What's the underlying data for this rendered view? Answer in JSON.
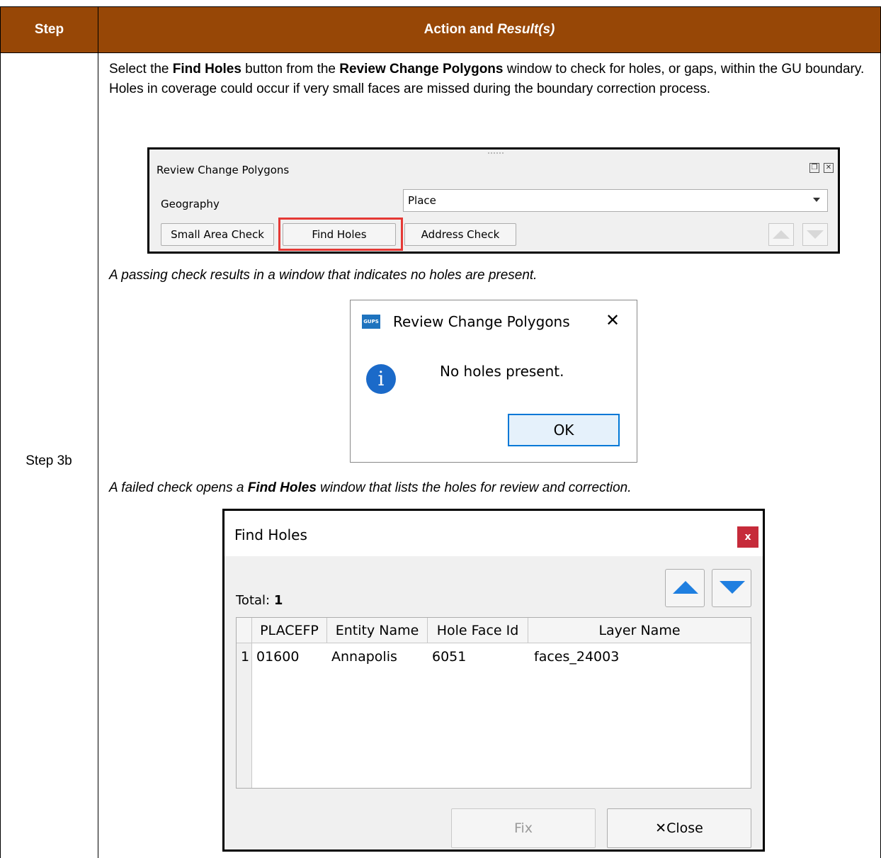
{
  "header": {
    "step_label": "Step",
    "action_label_plain": "Action and ",
    "action_label_italic": "Result(s)"
  },
  "row": {
    "step": "Step 3b",
    "instruction": {
      "p1": "Select the ",
      "b1": "Find Holes",
      "p2": " button from the ",
      "b2": "Review Change Polygons",
      "p3": " window to check for holes, or gaps, within the GU boundary. Holes in coverage could occur if very small faces are missed during the boundary correction process."
    },
    "pass_caption": "A passing check results in a window that indicates no holes are present.",
    "fail_caption": {
      "p1": "A failed check opens a ",
      "b1": "Find Holes",
      "p2": " window that lists the holes for review and correction."
    }
  },
  "review_panel": {
    "title": "Review Change Polygons",
    "geography_label": "Geography",
    "geography_value": "Place",
    "buttons": [
      "Small Area Check",
      "Find Holes",
      "Address Check"
    ]
  },
  "message_box": {
    "logo_text": "GUPS",
    "title": "Review Change Polygons",
    "close_glyph": "✕",
    "info_glyph": "i",
    "text": "No holes present.",
    "ok_label": "OK"
  },
  "find_holes": {
    "title": "Find Holes",
    "close_glyph": "x",
    "total_label": "Total:",
    "total_value": "1",
    "columns": [
      "PLACEFP",
      "Entity Name",
      "Hole Face Id",
      "Layer Name"
    ],
    "rows": [
      {
        "num": "1",
        "placefp": "01600",
        "entity_name": "Annapolis",
        "hole_face_id": "6051",
        "layer_name": "faces_24003"
      }
    ],
    "fix_label": "Fix",
    "close_label": "Close",
    "close_icon_glyph": "✕"
  }
}
